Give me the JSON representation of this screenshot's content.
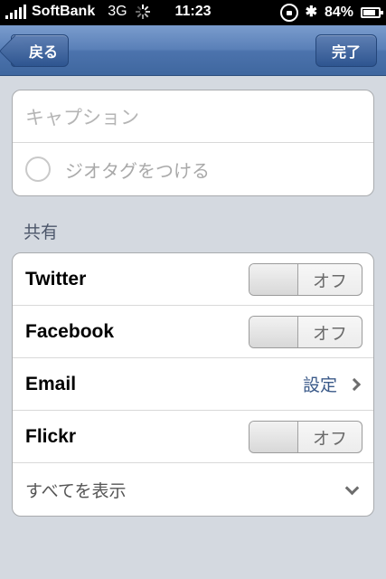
{
  "status_bar": {
    "carrier": "SoftBank",
    "network": "3G",
    "time": "11:23",
    "battery": "84%",
    "battery_level": 0.84,
    "icons": [
      "signal-icon",
      "activity-spinner-icon",
      "rotation-lock-icon",
      "bluetooth-icon",
      "battery-icon"
    ]
  },
  "nav": {
    "back_label": "戻る",
    "done_label": "完了"
  },
  "caption": {
    "placeholder": "キャプション"
  },
  "geotag": {
    "label": "ジオタグをつける"
  },
  "share": {
    "section_label": "共有",
    "items": [
      {
        "title": "Twitter",
        "control": "toggle",
        "value": "オフ"
      },
      {
        "title": "Facebook",
        "control": "toggle",
        "value": "オフ"
      },
      {
        "title": "Email",
        "control": "detail",
        "value": "設定"
      },
      {
        "title": "Flickr",
        "control": "toggle",
        "value": "オフ"
      }
    ],
    "show_all_label": "すべてを表示"
  },
  "colors": {
    "nav_bar": "#4c73ad",
    "background": "#d4d9e0",
    "detail_text": "#3b5a89"
  }
}
